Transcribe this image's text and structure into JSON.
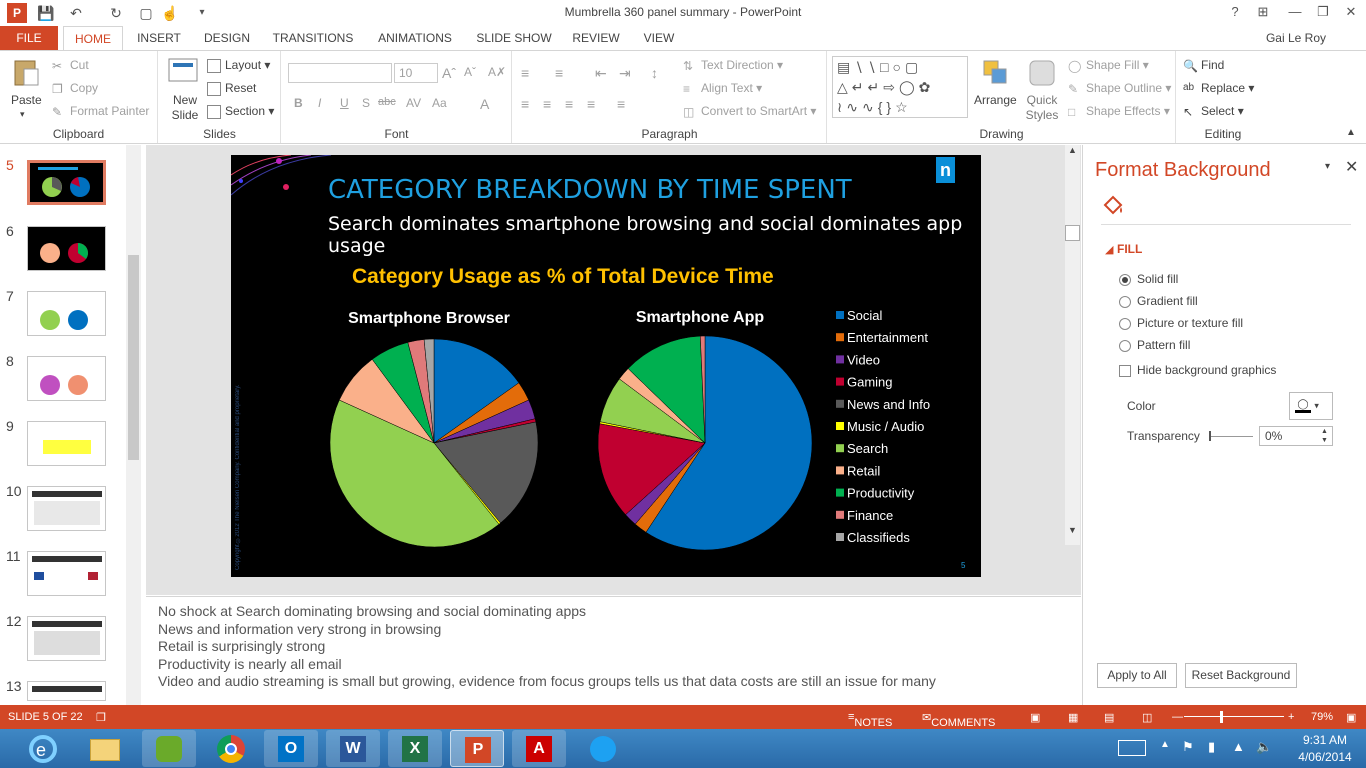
{
  "window": {
    "title": "Mumbrella 360 panel summary - PowerPoint",
    "user": "Gai Le Roy"
  },
  "tabs": [
    "FILE",
    "HOME",
    "INSERT",
    "DESIGN",
    "TRANSITIONS",
    "ANIMATIONS",
    "SLIDE SHOW",
    "REVIEW",
    "VIEW"
  ],
  "ribbon": {
    "clipboard": {
      "paste": "Paste",
      "cut": "Cut",
      "copy": "Copy",
      "format_painter": "Format Painter",
      "label": "Clipboard"
    },
    "slides": {
      "new_slide": "New Slide",
      "layout": "Layout",
      "reset": "Reset",
      "section": "Section",
      "label": "Slides"
    },
    "font": {
      "size": "10",
      "label": "Font",
      "bold": "B",
      "italic": "I",
      "underline": "U",
      "shadow": "S",
      "strike": "abc"
    },
    "paragraph": {
      "text_direction": "Text Direction",
      "align_text": "Align Text",
      "smartart": "Convert to SmartArt",
      "label": "Paragraph"
    },
    "drawing": {
      "arrange": "Arrange",
      "quick_styles": "Quick Styles",
      "shape_fill": "Shape Fill",
      "shape_outline": "Shape Outline",
      "shape_effects": "Shape Effects",
      "label": "Drawing"
    },
    "editing": {
      "find": "Find",
      "replace": "Replace",
      "select": "Select",
      "label": "Editing"
    }
  },
  "thumbnails": [
    "5",
    "6",
    "7",
    "8",
    "9",
    "10",
    "11",
    "12",
    "13"
  ],
  "slide": {
    "title": "CATEGORY BREAKDOWN BY TIME SPENT",
    "subtitle": "Search dominates smartphone browsing and social dominates app usage",
    "chart_title": "Category Usage as % of Total Device Time",
    "logo": "n",
    "footer_text": "Copyright ©2012 The Nielsen Company. Confidential and proprietary.",
    "page_num": "5"
  },
  "chart_data": [
    {
      "type": "pie",
      "title": "Smartphone Browser",
      "categories": [
        "Social",
        "Entertainment",
        "Video",
        "Gaming",
        "News and Info",
        "Music / Audio",
        "Search",
        "Retail",
        "Productivity",
        "Finance",
        "Classifieds"
      ],
      "values": [
        15,
        3,
        3,
        0.5,
        17,
        0.3,
        42,
        8,
        6,
        2.5,
        1.5
      ]
    },
    {
      "type": "pie",
      "title": "Smartphone App",
      "categories": [
        "Social",
        "Entertainment",
        "Video",
        "Gaming",
        "News and Info",
        "Music / Audio",
        "Search",
        "Retail",
        "Productivity",
        "Finance",
        "Classifieds"
      ],
      "values": [
        59,
        2,
        2,
        14.5,
        0,
        0.3,
        7,
        2,
        12,
        0.7,
        0
      ]
    }
  ],
  "legend": [
    {
      "label": "Social",
      "color": "#0070c0"
    },
    {
      "label": "Entertainment",
      "color": "#e36c0a"
    },
    {
      "label": "Video",
      "color": "#7030a0"
    },
    {
      "label": "Gaming",
      "color": "#c00030"
    },
    {
      "label": "News and Info",
      "color": "#595959"
    },
    {
      "label": "Music / Audio",
      "color": "#ffff00"
    },
    {
      "label": "Search",
      "color": "#92d050"
    },
    {
      "label": "Retail",
      "color": "#fab08a"
    },
    {
      "label": "Productivity",
      "color": "#00b050"
    },
    {
      "label": "Finance",
      "color": "#e07a7a"
    },
    {
      "label": "Classifieds",
      "color": "#a6a6a6"
    }
  ],
  "notes": [
    "No shock at Search dominating browsing and social dominating apps",
    "News and information very strong in browsing",
    "Retail is surprisingly strong",
    "Productivity is nearly all email",
    "Video and audio streaming is small but growing, evidence from focus groups tells us that data costs are still an issue for many"
  ],
  "format_pane": {
    "title": "Format Background",
    "section": "FILL",
    "options": [
      "Solid fill",
      "Gradient fill",
      "Picture or texture fill",
      "Pattern fill"
    ],
    "hide_bg": "Hide background graphics",
    "color_label": "Color",
    "transparency_label": "Transparency",
    "transparency_value": "0%",
    "apply_all": "Apply to All",
    "reset_bg": "Reset Background"
  },
  "status": {
    "slide": "SLIDE 5 OF 22",
    "notes": "NOTES",
    "comments": "COMMENTS",
    "zoom": "79%"
  },
  "clock": {
    "time": "9:31 AM",
    "date": "4/06/2014"
  }
}
